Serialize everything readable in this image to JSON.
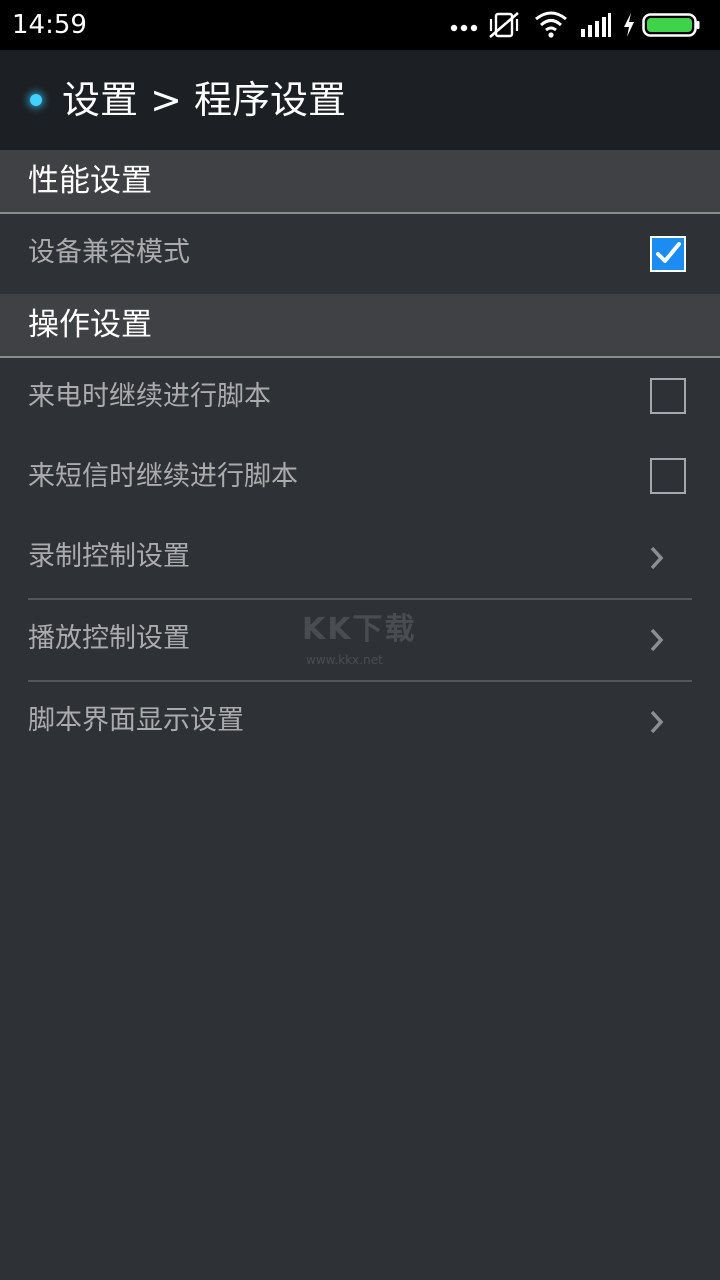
{
  "status_bar": {
    "time": "14:59",
    "icons": [
      "more-dots-icon",
      "vibrate-off-icon",
      "wifi-icon",
      "signal-icon",
      "charging-icon",
      "battery-icon"
    ],
    "battery_color": "#3ed34a"
  },
  "header": {
    "title": "设置 > 程序设置",
    "accent_color": "#3fd2ff"
  },
  "sections": [
    {
      "title": "性能设置",
      "items": [
        {
          "label": "设备兼容模式",
          "control": "checkbox",
          "checked": true
        }
      ]
    },
    {
      "title": "操作设置",
      "items": [
        {
          "label": "来电时继续进行脚本",
          "control": "checkbox",
          "checked": false
        },
        {
          "label": "来短信时继续进行脚本",
          "control": "checkbox",
          "checked": false
        },
        {
          "label": "录制控制设置",
          "control": "chevron"
        },
        {
          "label": "播放控制设置",
          "control": "chevron"
        },
        {
          "label": "脚本界面显示设置",
          "control": "chevron"
        }
      ]
    }
  ],
  "watermark": {
    "logo": "KK下载",
    "url": "www.kkx.net"
  }
}
